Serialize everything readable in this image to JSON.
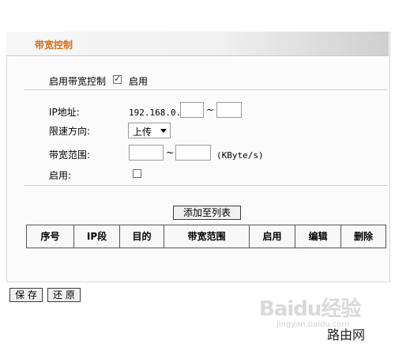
{
  "section": {
    "title": "带宽控制"
  },
  "controls": {
    "enable_bandwidth_label": "启用带宽控制",
    "enable_bandwidth_checked": true,
    "enable_bandwidth_suffix": "启用"
  },
  "form": {
    "ip_label": "IP地址:",
    "ip_prefix": "192.168.0.",
    "ip_separator": "~",
    "direction_label": "限速方向:",
    "direction_value": "上传",
    "range_label": "带宽范围:",
    "range_separator": "~",
    "range_unit": "(KByte/s)",
    "enable_label": "启用:",
    "enable_checked": false
  },
  "actions": {
    "add_to_list": "添加至列表",
    "save": "保 存",
    "restore": "还 原"
  },
  "table": {
    "headers": [
      "序号",
      "IP段",
      "目的",
      "带宽范围",
      "启用",
      "编辑",
      "删除"
    ]
  },
  "watermark": {
    "main": "Baidu经验",
    "sub": "jingyan.baidu.com",
    "brand": "路由网"
  },
  "colors": {
    "title": "#d46f1a"
  }
}
